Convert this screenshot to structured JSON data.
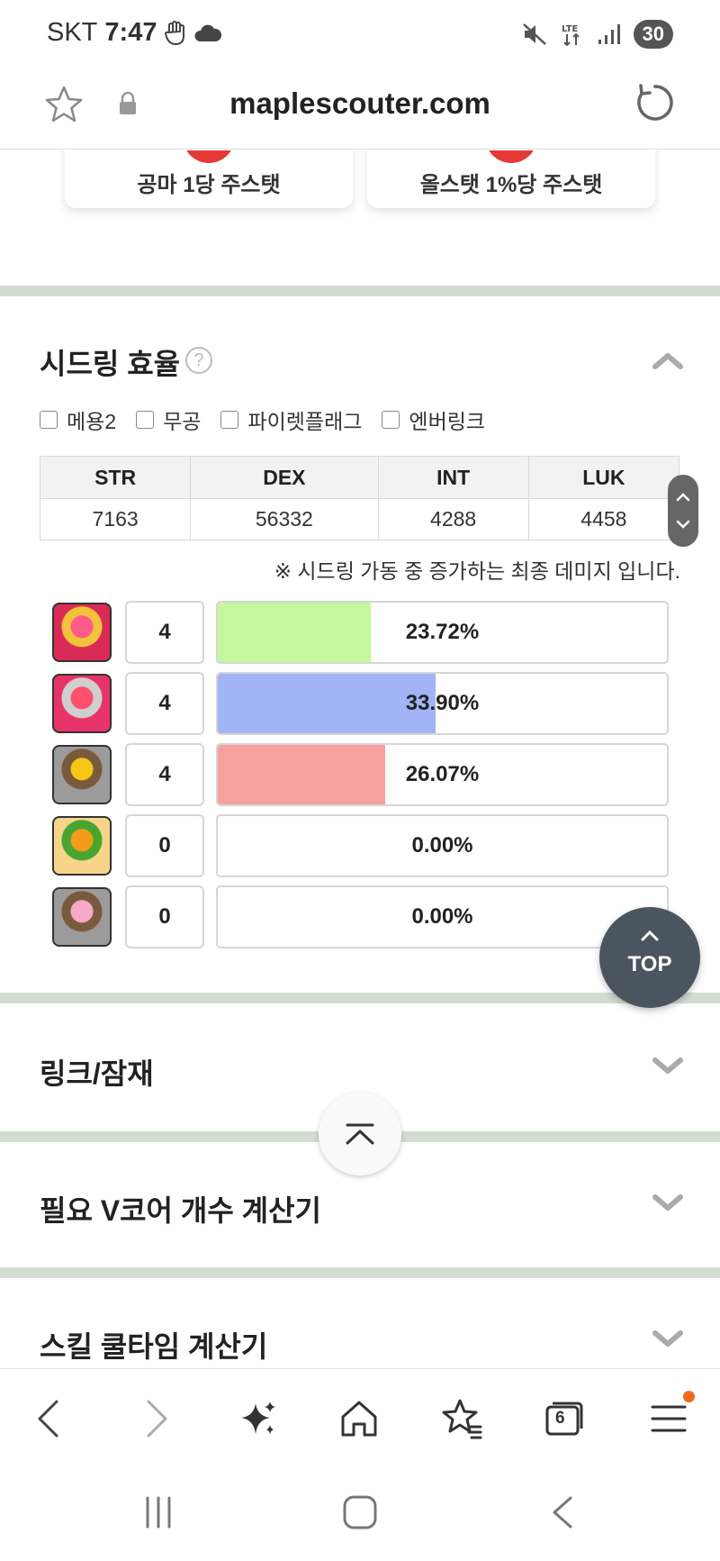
{
  "status_bar": {
    "carrier": "SKT",
    "time": "7:47",
    "battery": "30"
  },
  "browser": {
    "url": "maplescouter.com",
    "tab_count": "6"
  },
  "top_cards": [
    {
      "label": "공마 1당 주스탯"
    },
    {
      "label": "올스탯 1%당 주스탯"
    }
  ],
  "seed_ring": {
    "title": "시드링 효율",
    "help": "?",
    "checkboxes": [
      {
        "label": "메용2",
        "checked": false
      },
      {
        "label": "무공",
        "checked": false
      },
      {
        "label": "파이렛플래그",
        "checked": false
      },
      {
        "label": "엔버링크",
        "checked": false
      }
    ],
    "stats": {
      "headers": [
        "STR",
        "DEX",
        "INT",
        "LUK"
      ],
      "values": [
        "7163",
        "56332",
        "4288",
        "4458"
      ]
    },
    "note": "※ 시드링 가동 중 증가하는 최종 데미지 입니다.",
    "rings": [
      {
        "icon": "ring-icon",
        "level": "4",
        "percent": "23.72%",
        "fill": 0.34,
        "color": "#c5f79c"
      },
      {
        "icon": "ring-icon",
        "level": "4",
        "percent": "33.90%",
        "fill": 0.485,
        "color": "#a1b4f5"
      },
      {
        "icon": "ring-icon",
        "level": "4",
        "percent": "26.07%",
        "fill": 0.373,
        "color": "#f6a0a0"
      },
      {
        "icon": "ring-icon",
        "level": "0",
        "percent": "0.00%",
        "fill": 0,
        "color": "#ffffff"
      },
      {
        "icon": "ring-icon",
        "level": "0",
        "percent": "0.00%",
        "fill": 0,
        "color": "#ffffff"
      }
    ]
  },
  "sections": [
    {
      "title": "링크/잠재"
    },
    {
      "title": "필요 V코어 개수 계산기"
    },
    {
      "title": "스킬 쿨타임 계산기"
    }
  ],
  "top_button": {
    "label": "TOP"
  }
}
